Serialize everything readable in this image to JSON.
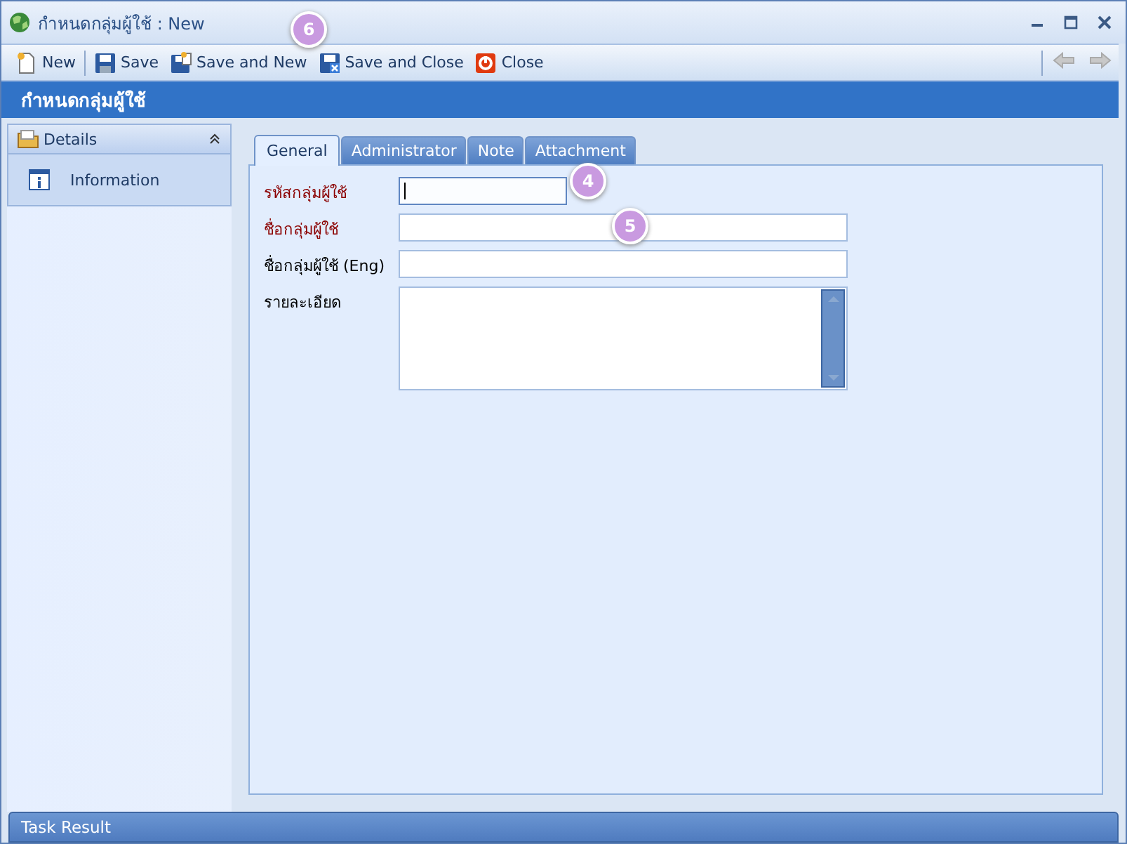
{
  "window": {
    "title": "กำหนดกลุ่มผู้ใช้ : New"
  },
  "toolbar": [
    {
      "kind": "new",
      "label": "New"
    },
    {
      "kind": "save",
      "label": "Save"
    },
    {
      "kind": "save-new",
      "label": "Save and New"
    },
    {
      "kind": "save-close",
      "label": "Save and Close"
    },
    {
      "kind": "close",
      "label": "Close"
    }
  ],
  "nav": [
    {
      "kind": "back",
      "disabled": true
    },
    {
      "kind": "forward",
      "disabled": true
    }
  ],
  "header": "กำหนดกลุ่มผู้ใช้",
  "sidebar": {
    "group": "Details",
    "expanded": true,
    "items": [
      {
        "label": "Information"
      }
    ]
  },
  "tabs": [
    {
      "label": "General",
      "selected": true
    },
    {
      "label": "Administrator",
      "selected": false
    },
    {
      "label": "Note",
      "selected": false
    },
    {
      "label": "Attachment",
      "selected": false
    }
  ],
  "fields": [
    {
      "label": "รหัสกลุ่มผู้ใช้",
      "required": true,
      "kind": "short",
      "focused": true
    },
    {
      "label": "ชื่อกลุ่มผู้ใช้",
      "required": true,
      "kind": "text",
      "focused": false
    },
    {
      "label": "ชื่อกลุ่มผู้ใช้ (Eng)",
      "required": false,
      "kind": "text",
      "focused": false
    },
    {
      "label": "รายละเอียด",
      "required": false,
      "kind": "memo",
      "focused": false
    }
  ],
  "callouts": [
    "6",
    "4",
    "5"
  ],
  "status_bar": "Task Result"
}
